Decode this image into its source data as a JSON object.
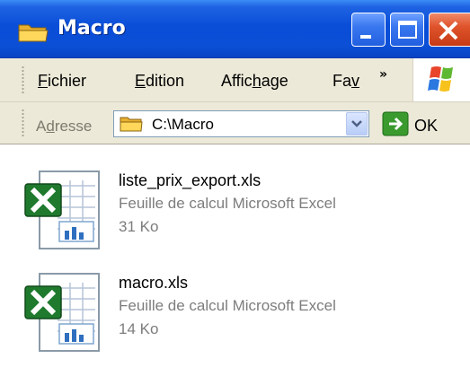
{
  "window": {
    "title": "Macro"
  },
  "menu": {
    "items": [
      {
        "pre": "",
        "key": "F",
        "post": "ichier"
      },
      {
        "pre": "",
        "key": "E",
        "post": "dition"
      },
      {
        "pre": "Affic",
        "key": "h",
        "post": "age"
      },
      {
        "pre": "Fa",
        "key": "v",
        "post": ""
      }
    ],
    "overflow": "»"
  },
  "address": {
    "label_pre": "A",
    "label_key": "d",
    "label_post": "resse",
    "value": "C:\\Macro",
    "go_label": "OK"
  },
  "files": [
    {
      "name": "liste_prix_export.xls",
      "type": "Feuille de calcul Microsoft Excel",
      "size": "31 Ko"
    },
    {
      "name": "macro.xls",
      "type": "Feuille de calcul Microsoft Excel",
      "size": "14 Ko"
    }
  ],
  "colors": {
    "titlebar": "#0a4ed8",
    "close_button": "#e0542c",
    "excel_green": "#1f7a2e"
  }
}
